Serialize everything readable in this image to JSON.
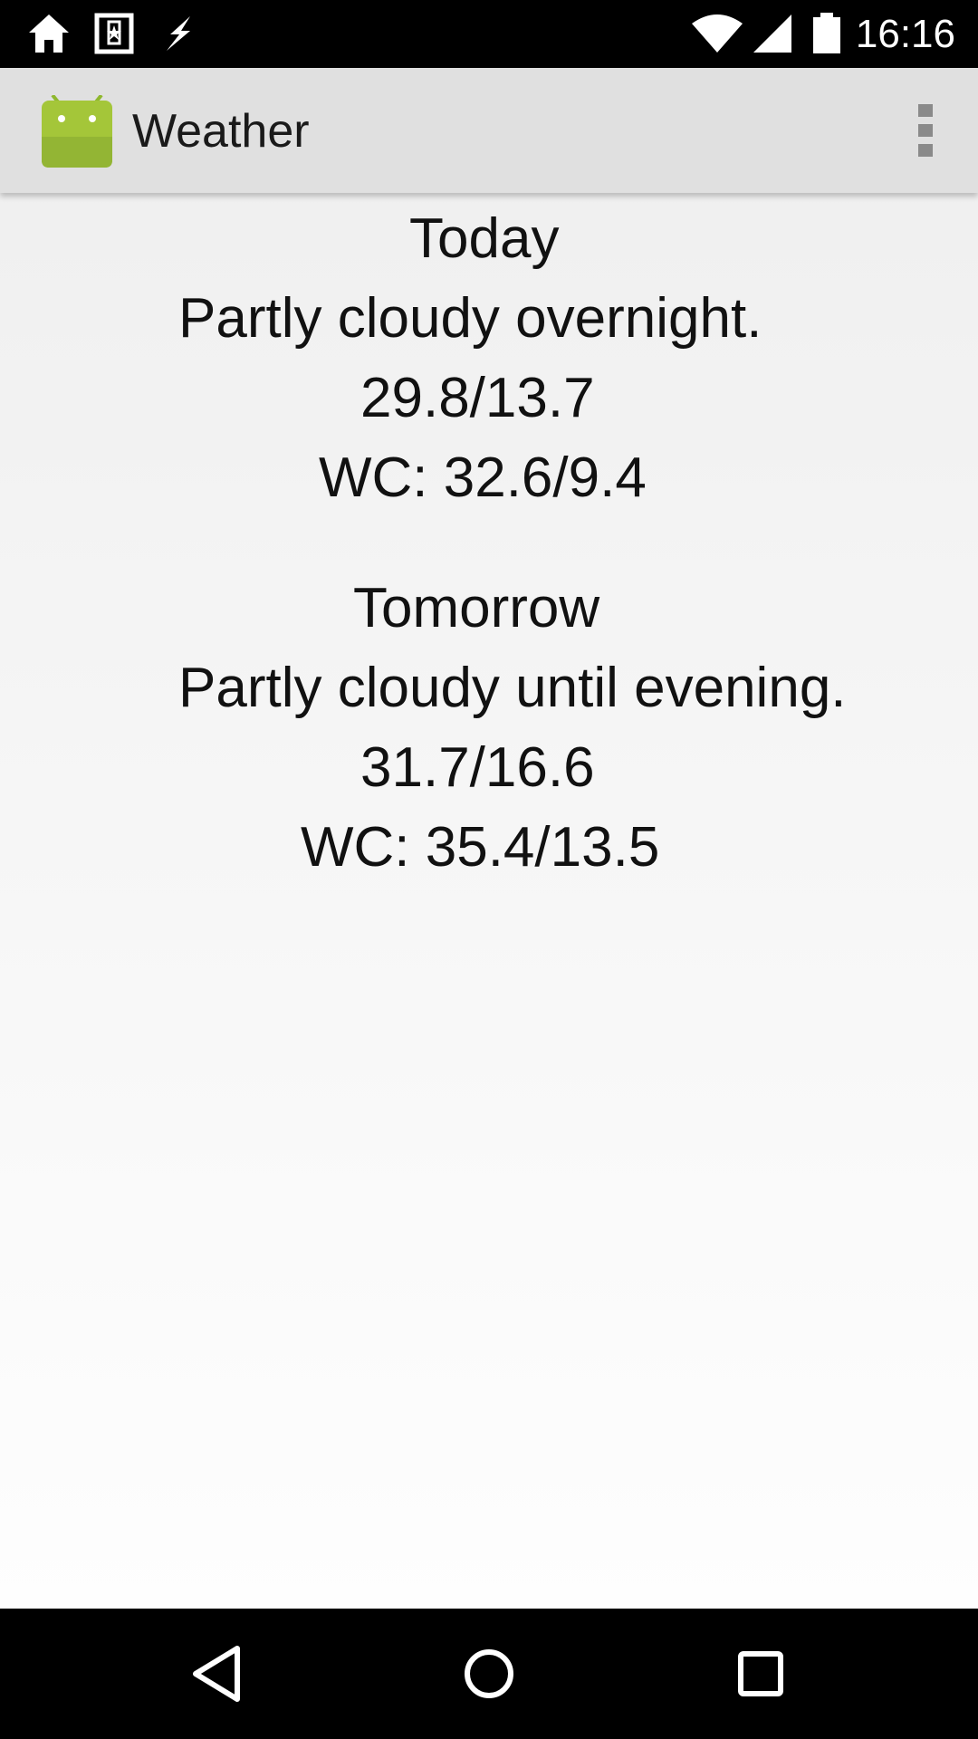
{
  "status_bar": {
    "time": "16:16",
    "icons": [
      "home-icon",
      "bookmark-app-icon",
      "flash-icon",
      "wifi-icon",
      "cell-signal-icon",
      "battery-icon"
    ]
  },
  "app": {
    "title": "Weather",
    "logo_icon": "android-logo-icon",
    "menu_icon": "overflow-menu-icon"
  },
  "forecast": {
    "today": {
      "heading": "Today",
      "summary": "Partly cloudy overnight.",
      "temps": "29.8/13.7",
      "wind_chill": "WC: 32.6/9.4"
    },
    "tomorrow": {
      "heading": "Tomorrow",
      "summary": "Partly cloudy until evening.",
      "temps": "31.7/16.6",
      "wind_chill": "WC: 35.4/13.5"
    }
  },
  "nav_bar": {
    "buttons": [
      "back-icon",
      "home-icon",
      "recents-icon"
    ]
  },
  "colors": {
    "status_bar": "#000000",
    "action_bar": "#e0e0e0",
    "android_green": "#a4c639",
    "text": "#111111"
  }
}
